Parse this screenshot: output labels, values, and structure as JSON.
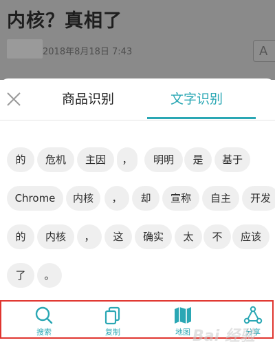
{
  "article": {
    "title": "内核？真相了",
    "date": "2018年8月18日 7:43",
    "font_button": "A"
  },
  "sheet": {
    "tabs": [
      {
        "label": "商品识别",
        "active": false
      },
      {
        "label": "文字识别",
        "active": true
      }
    ],
    "words": [
      "的",
      "危机",
      "主因",
      "，",
      "明明",
      "是",
      "基于",
      "Chrome",
      "内核",
      "，",
      "却",
      "宣称",
      "自主",
      "开发",
      "的",
      "内核",
      "，",
      "这",
      "确实",
      "太",
      "不",
      "应该",
      "了",
      "。"
    ]
  },
  "toolbar": {
    "items": [
      {
        "label": "搜索",
        "icon": "search-icon"
      },
      {
        "label": "复制",
        "icon": "copy-icon"
      },
      {
        "label": "地图",
        "icon": "map-icon"
      },
      {
        "label": "分享",
        "icon": "share-icon"
      }
    ]
  },
  "colors": {
    "accent": "#2aa7b4",
    "highlight_border": "#e0352f",
    "chip_bg": "#efefef",
    "dim_overlay": "#8a8a8a"
  },
  "watermark": "Bai 经验"
}
